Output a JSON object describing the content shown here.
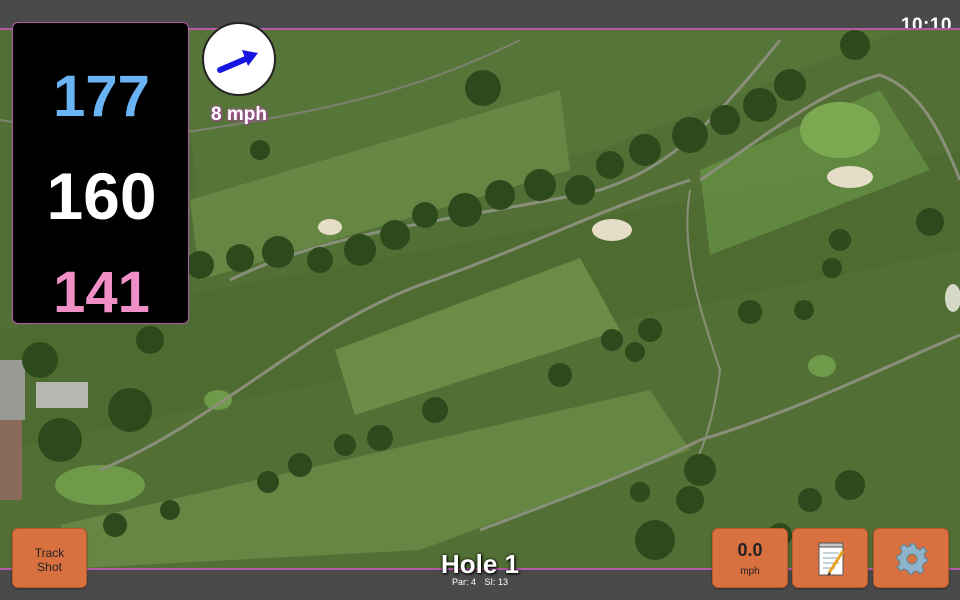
{
  "status_bar": {
    "time": "10:10"
  },
  "distances": {
    "back": "177",
    "middle": "160",
    "front": "141"
  },
  "wind": {
    "speed_label": "8 mph",
    "direction_icon": "wind-arrow-icon"
  },
  "buttons": {
    "track_shot": {
      "line1": "Track",
      "line2": "Shot"
    },
    "speed": {
      "value": "0.0",
      "unit": "mph"
    },
    "notes_icon": "notepad-icon",
    "settings_icon": "gear-icon"
  },
  "hole": {
    "title": "Hole 1",
    "par": "Par: 4",
    "si": "SI: 13"
  },
  "colors": {
    "back_distance": "#6ab4f5",
    "middle_distance": "#ffffff",
    "front_distance": "#f08fc5",
    "button": "#d8713f",
    "accent": "#b35aa8",
    "wind_arrow": "#1616e0"
  }
}
